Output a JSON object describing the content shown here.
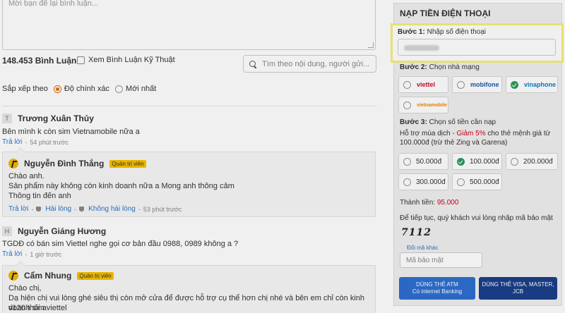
{
  "comments_section": {
    "textarea_placeholder": "Mời bạn để lại bình luận...",
    "count_label": "148.453 Bình Luận",
    "tech_filter_label": "Xem Bình Luận Kỹ Thuật",
    "search_placeholder": "Tìm theo nội dung, người gửi...",
    "sort_label": "Sắp xếp theo",
    "sort_options": [
      "Độ chính xác",
      "Mới nhất"
    ],
    "reply_label": "Trả lời",
    "like_label": "Hài lòng",
    "dislike_label": "Không hài lòng",
    "admin_badge": "Quản trị viên",
    "comments": [
      {
        "initial": "T",
        "name": "Trương Xuân Thủy",
        "text": "Bên mình k còn sim Vietnamobile nữa a",
        "time": "54 phút trước",
        "reply": {
          "name": "Nguyễn Đình Thắng",
          "lines": [
            "Chào anh.",
            "Sản phẩm này không còn kinh doanh nữa a Mong anh thông cảm",
            "Thông tin đến anh"
          ],
          "time": "53 phút trước"
        }
      },
      {
        "initial": "H",
        "name": "Nguyễn Giáng Hương",
        "text": "TGDĐ có bán sim Viettel nghe gọi cơ bản đầu 0988, 0989 không a ?",
        "time": "1 giờ trước",
        "reply": {
          "name": "Cẩm Nhung",
          "lines": [
            "Chào chị,",
            "Dạ hiện chị vui lòng ghé siêu thị còn mở cửa để được hỗ trợ cụ thể hơn chị nhé và bên em chỉ còn kinh doanh sim viettel",
            "v120 thôi a"
          ]
        }
      }
    ]
  },
  "topup": {
    "title": "NẠP TIỀN ĐIỆN THOẠI",
    "step1_prefix": "Bước 1:",
    "step1_text": "Nhập số điện thoại",
    "step2_prefix": "Bước 2:",
    "step2_text": "Chọn nhà mạng",
    "carriers": [
      {
        "name": "viettel",
        "color": "#c8102e",
        "selected": false
      },
      {
        "name": "mobifone",
        "color": "#1e5aa8",
        "selected": false
      },
      {
        "name": "vinaphone",
        "color": "#0a7fc1",
        "selected": true
      },
      {
        "name": "vietnamobile",
        "color": "#f08a00",
        "selected": false
      }
    ],
    "step3_prefix": "Bước 3:",
    "step3_text": "Chọn số tiền cần nạp",
    "support_text_a": "Hỗ trợ mùa dịch - ",
    "support_discount": "Giảm 5%",
    "support_text_b": " cho thẻ mệnh giá từ",
    "support_text_c": "100.000đ (trừ thẻ Zing và Garena)",
    "amounts": [
      {
        "value": "50.000đ",
        "selected": false
      },
      {
        "value": "100.000đ",
        "selected": true
      },
      {
        "value": "200.000đ",
        "selected": false
      },
      {
        "value": "300.000đ",
        "selected": false
      },
      {
        "value": "500.000đ",
        "selected": false
      }
    ],
    "total_label": "Thành tiền:",
    "total_value": "95.000",
    "captcha_prompt": "Để tiếp tục, quý khách vui lòng nhập mã bảo mật",
    "captcha_code": "7112",
    "captcha_refresh": "Đổi mã khác",
    "captcha_placeholder": "Mã bảo mật",
    "btn_atm_line1": "DÙNG THẺ ATM",
    "btn_atm_line2": "Có internet Banking",
    "btn_visa_line1": "DÙNG THẺ VISA, MASTER,",
    "btn_visa_line2": "JCB",
    "colors": {
      "discount": "#d0021b",
      "btn_atm": "#2e6fd0",
      "btn_visa": "#1a3f8a",
      "highlight": "#f5f07a"
    }
  }
}
